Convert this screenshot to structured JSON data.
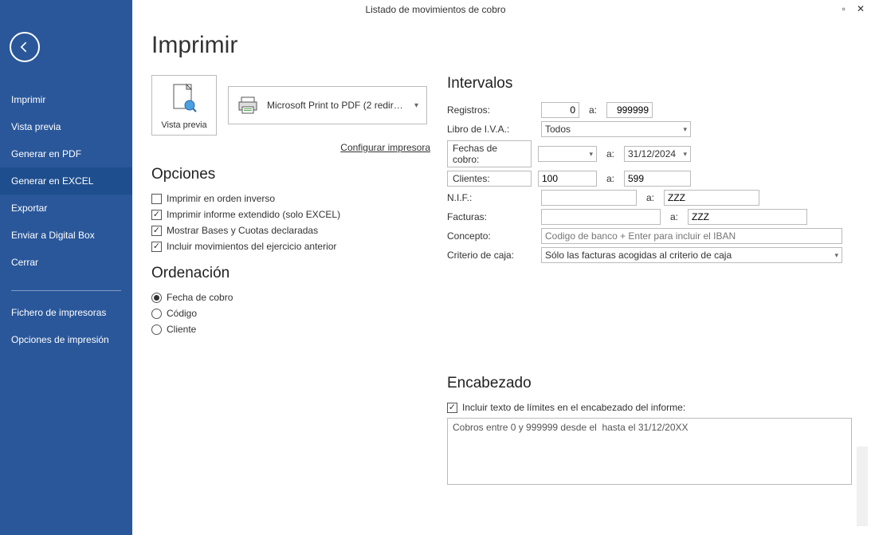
{
  "window": {
    "title": "Listado de movimientos de cobro"
  },
  "sidebar": {
    "items": [
      {
        "label": "Imprimir"
      },
      {
        "label": "Vista previa"
      },
      {
        "label": "Generar en PDF"
      },
      {
        "label": "Generar en EXCEL"
      },
      {
        "label": "Exportar"
      },
      {
        "label": "Enviar a Digital Box"
      },
      {
        "label": "Cerrar"
      }
    ],
    "active_index": 3,
    "secondary": [
      {
        "label": "Fichero de impresoras"
      },
      {
        "label": "Opciones de impresión"
      }
    ]
  },
  "page": {
    "title": "Imprimir",
    "preview_button": "Vista previa",
    "printer_name": "Microsoft Print to PDF (2 redirecc...",
    "config_link": "Configurar impresora"
  },
  "sections": {
    "opciones": "Opciones",
    "ordenacion": "Ordenación",
    "intervalos": "Intervalos",
    "encabezado": "Encabezado"
  },
  "opciones": {
    "orden_inverso": {
      "label": "Imprimir en orden inverso",
      "checked": false
    },
    "extendido": {
      "label": "Imprimir informe extendido (solo EXCEL)",
      "checked": true
    },
    "bases": {
      "label": "Mostrar Bases y Cuotas declaradas",
      "checked": true
    },
    "anterior": {
      "label": "Incluir movimientos del ejercicio anterior",
      "checked": true
    }
  },
  "ordenacion": {
    "fecha": {
      "label": "Fecha de cobro",
      "checked": true
    },
    "codigo": {
      "label": "Código",
      "checked": false
    },
    "cliente": {
      "label": "Cliente",
      "checked": false
    }
  },
  "intervalos": {
    "registros": {
      "label": "Registros:",
      "from": "0",
      "to": "999999",
      "sep": "a:"
    },
    "libro": {
      "label": "Libro de I.V.A.:",
      "value": "Todos"
    },
    "fechas_btn": "Fechas de cobro:",
    "fechas": {
      "from": "",
      "to": "31/12/2024",
      "sep": "a:"
    },
    "clientes_btn": "Clientes:",
    "clientes": {
      "from": "100",
      "to": "599",
      "sep": "a:"
    },
    "nif": {
      "label": "N.I.F.:",
      "from": "",
      "to": "ZZZ",
      "sep": "a:"
    },
    "facturas": {
      "label": "Facturas:",
      "from": "",
      "to": "ZZZ",
      "sep": "a:"
    },
    "concepto": {
      "label": "Concepto:",
      "placeholder": "Codigo de banco + Enter para incluir el IBAN"
    },
    "criterio": {
      "label": "Criterio de caja:",
      "value": "Sólo las facturas acogidas al criterio de caja"
    }
  },
  "encabezado": {
    "incluir": {
      "label": "Incluir texto de límites en el encabezado del informe:",
      "checked": true
    },
    "text": "Cobros entre 0 y 999999 desde el  hasta el 31/12/20XX"
  }
}
